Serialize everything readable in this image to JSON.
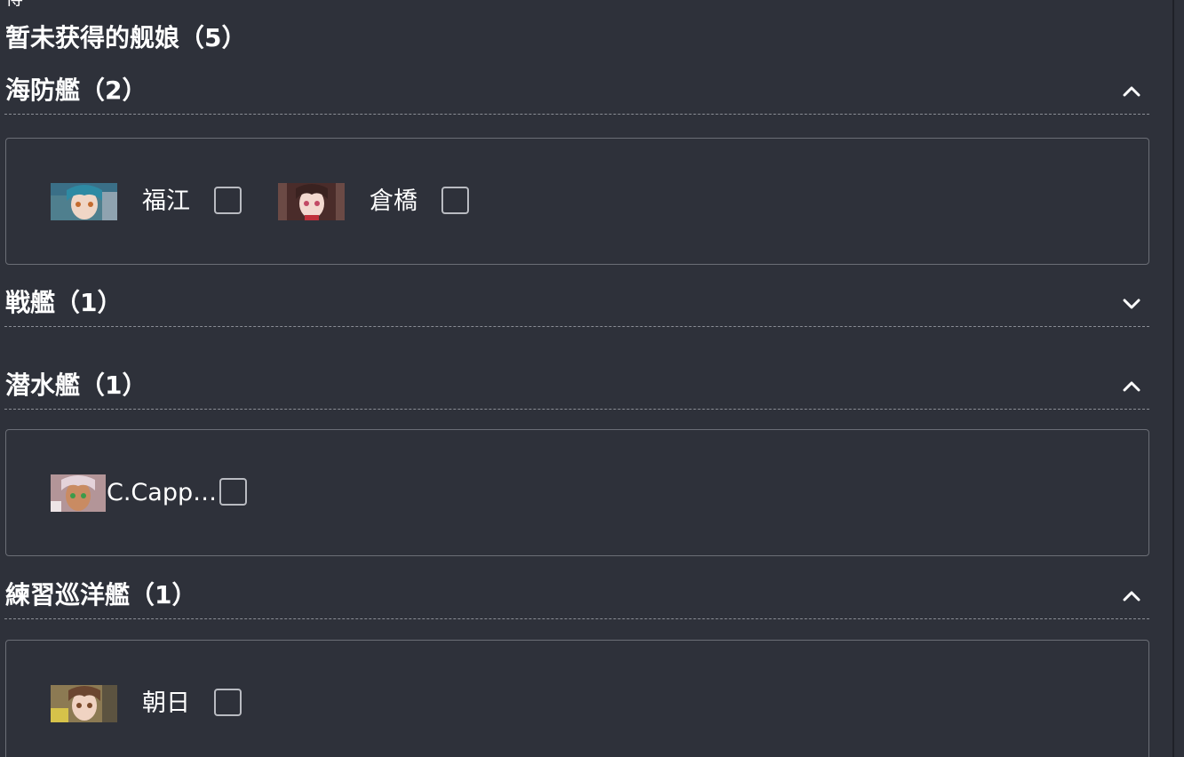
{
  "top_fragment": "得",
  "page_title": "暂未获得的舰娘（5）",
  "sections": [
    {
      "title": "海防艦（2）",
      "expanded": true,
      "chevron": "chevron-up-icon",
      "ships": [
        {
          "name": "福江",
          "checked": false,
          "portrait": "fukae-portrait"
        },
        {
          "name": "倉橋",
          "checked": false,
          "portrait": "kurahashi-portrait"
        }
      ]
    },
    {
      "title": "戦艦（1）",
      "expanded": false,
      "chevron": "chevron-down-icon",
      "ships": []
    },
    {
      "title": "潜水艦（1）",
      "expanded": true,
      "chevron": "chevron-up-icon",
      "ships": [
        {
          "name": "C.Capp…",
          "checked": false,
          "portrait": "cappellini-portrait"
        }
      ]
    },
    {
      "title": "練習巡洋艦（1）",
      "expanded": true,
      "chevron": "chevron-up-icon",
      "ships": [
        {
          "name": "朝日",
          "checked": false,
          "portrait": "asahi-portrait"
        }
      ]
    }
  ],
  "colors": {
    "background": "#2e313a",
    "text": "#ffffff",
    "border": "#6b6e76",
    "checkbox_border": "#b9bbc1"
  }
}
